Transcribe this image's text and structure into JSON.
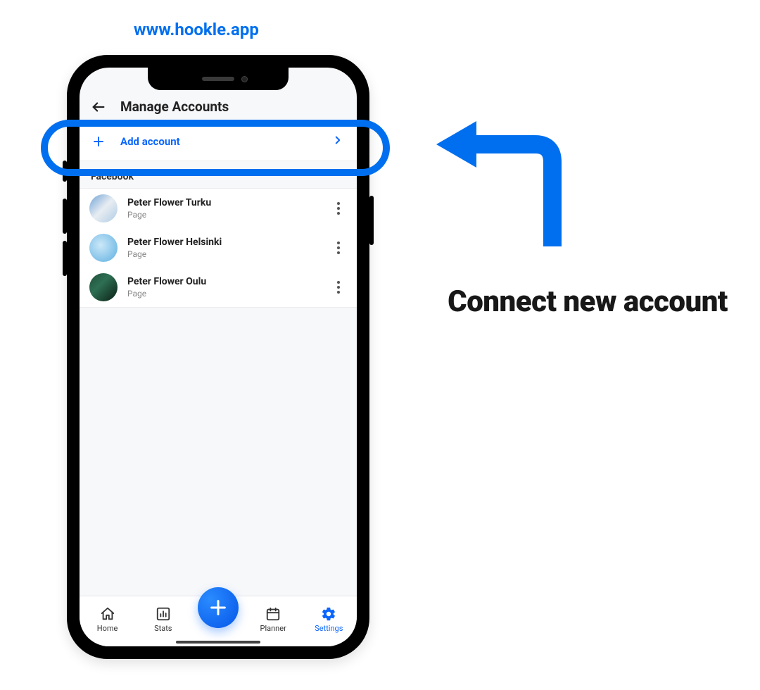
{
  "url_label": "www.hookle.app",
  "header": {
    "title": "Manage Accounts"
  },
  "add_row": {
    "label": "Add account"
  },
  "section": {
    "title": "Facebook"
  },
  "accounts": [
    {
      "name": "Peter Flower Turku",
      "sub": "Page"
    },
    {
      "name": "Peter Flower Helsinki",
      "sub": "Page"
    },
    {
      "name": "Peter Flower Oulu",
      "sub": "Page"
    }
  ],
  "nav": {
    "home": "Home",
    "stats": "Stats",
    "planner": "Planner",
    "settings": "Settings"
  },
  "callout": "Connect new account",
  "colors": {
    "accent": "#006fef",
    "link": "#0a66ff"
  }
}
